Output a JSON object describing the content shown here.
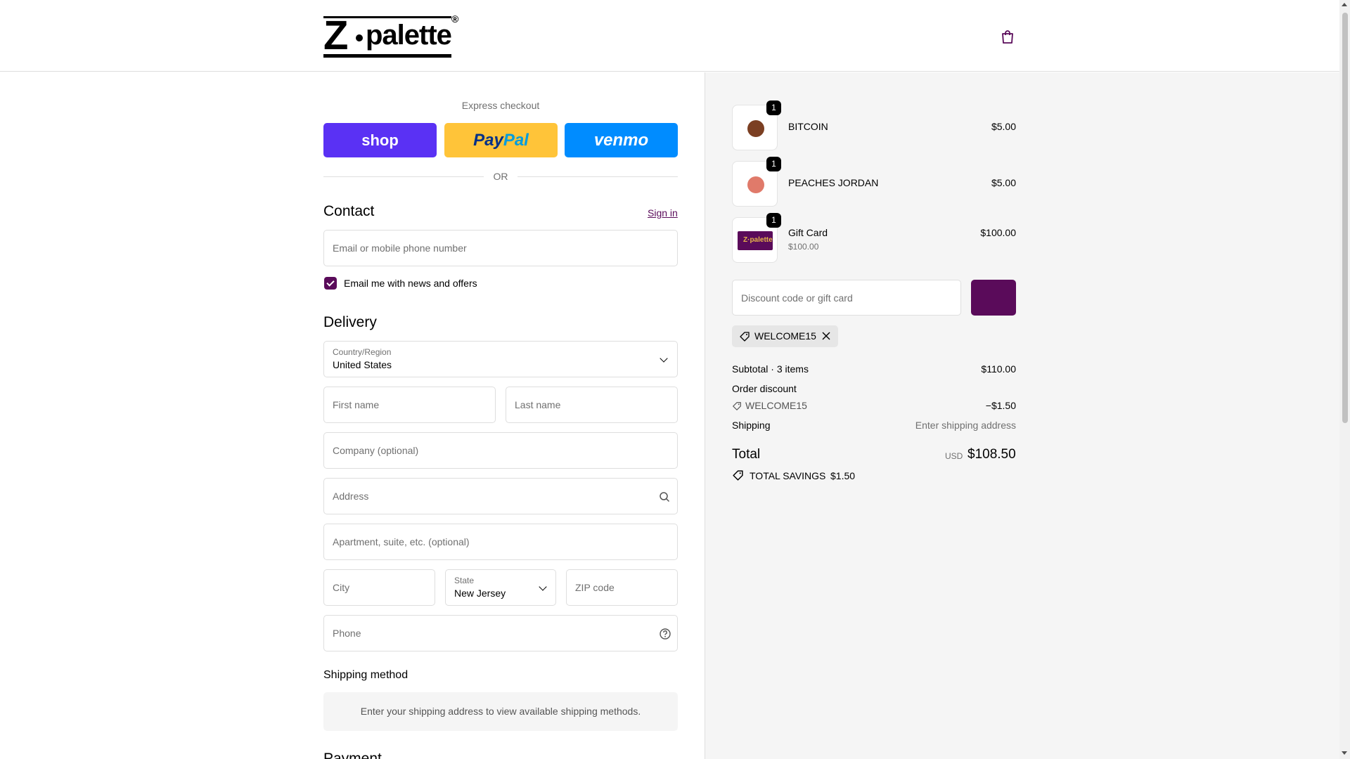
{
  "header": {
    "brand": "Z",
    "brand_rest": "palette",
    "brand_reg": "®"
  },
  "express": {
    "title": "Express checkout",
    "shop_label": "shop",
    "paypal_label_1": "Pay",
    "paypal_label_2": "Pal",
    "venmo_label": "venmo",
    "or": "OR"
  },
  "contact": {
    "title": "Contact",
    "signin": "Sign in",
    "email_placeholder": "Email or mobile phone number",
    "newsletter_label": "Email me with news and offers"
  },
  "delivery": {
    "title": "Delivery",
    "country_label": "Country/Region",
    "country_value": "United States",
    "first_name": "First name",
    "last_name": "Last name",
    "company": "Company (optional)",
    "address": "Address",
    "apartment": "Apartment, suite, etc. (optional)",
    "city": "City",
    "state_label": "State",
    "state_value": "New Jersey",
    "zip": "ZIP code",
    "phone": "Phone"
  },
  "shipping_method": {
    "title": "Shipping method",
    "message": "Enter your shipping address to view available shipping methods."
  },
  "payment": {
    "title": "Payment"
  },
  "summary": {
    "items": [
      {
        "name": "BITCOIN",
        "qty": "1",
        "price": "$5.00",
        "swatch": "#7b3f22"
      },
      {
        "name": "PEACHES JORDAN",
        "qty": "1",
        "price": "$5.00",
        "swatch": "#e07a6a"
      },
      {
        "name": "Gift Card",
        "qty": "1",
        "price": "$100.00",
        "sub": "$100.00",
        "card_text": "Z·palette"
      }
    ],
    "discount_placeholder": "Discount code or gift card",
    "applied_code": "WELCOME15",
    "subtotal_label": "Subtotal · 3 items",
    "subtotal_value": "$110.00",
    "order_discount_label": "Order discount",
    "discount_code": "WELCOME15",
    "discount_value": "−$1.50",
    "shipping_label": "Shipping",
    "shipping_value": "Enter shipping address",
    "total_label": "Total",
    "currency": "USD",
    "total_value": "$108.50",
    "savings_label": "TOTAL SAVINGS",
    "savings_value": "$1.50"
  },
  "colors": {
    "accent": "#5a0b5a",
    "shop": "#5a31f4",
    "paypal": "#ffc439",
    "venmo": "#008cff"
  }
}
